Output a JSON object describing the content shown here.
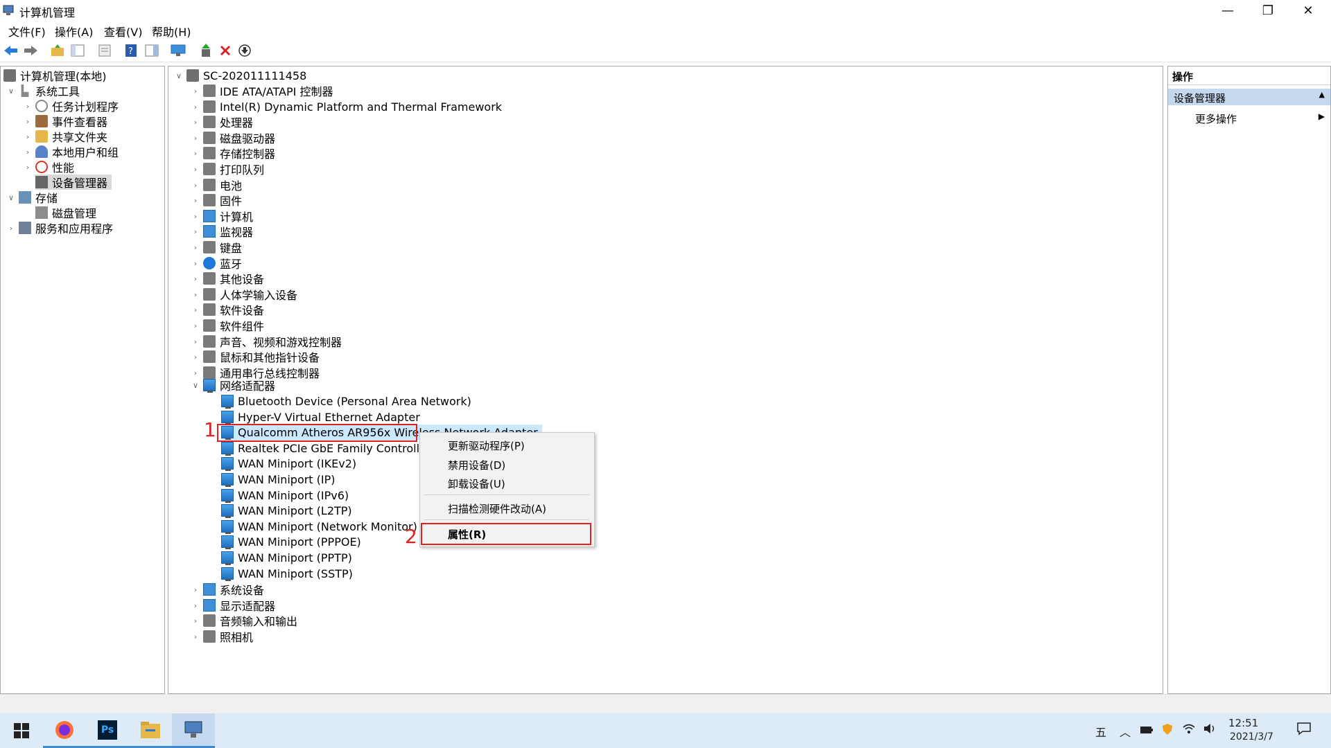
{
  "window": {
    "title": "计算机管理",
    "minimize": "—",
    "restore": "❐",
    "close": "✕"
  },
  "menu": [
    "文件(F)",
    "操作(A)",
    "查看(V)",
    "帮助(H)"
  ],
  "toolbar_icons": [
    "back-arrow-icon",
    "forward-arrow-icon",
    "up-folder-icon",
    "show-hide-tree-icon",
    "export-list-icon",
    "help-icon",
    "details-pane-icon",
    "monitor-icon",
    "update-driver-icon",
    "uninstall-x-icon",
    "download-icon"
  ],
  "left_tree": {
    "root": "计算机管理(本地)",
    "system_tools": "系统工具",
    "task_scheduler": "任务计划程序",
    "event_viewer": "事件查看器",
    "shared_folders": "共享文件夹",
    "local_users": "本地用户和组",
    "performance": "性能",
    "device_manager": "设备管理器",
    "storage": "存储",
    "disk_management": "磁盘管理",
    "services_apps": "服务和应用程序"
  },
  "device_tree": {
    "computer_name": "SC-202011111458",
    "categories_top": [
      "IDE ATA/ATAPI 控制器",
      "Intel(R) Dynamic Platform and Thermal Framework",
      "处理器",
      "磁盘驱动器",
      "存储控制器",
      "打印队列",
      "电池",
      "固件",
      "计算机",
      "监视器",
      "键盘",
      "蓝牙",
      "其他设备",
      "人体学输入设备",
      "软件设备",
      "软件组件",
      "声音、视频和游戏控制器",
      "鼠标和其他指针设备",
      "通用串行总线控制器"
    ],
    "network_adapters": "网络适配器",
    "adapters": [
      "Bluetooth Device (Personal Area Network)",
      "Hyper-V Virtual Ethernet Adapter",
      "Qualcomm Atheros AR956x Wireless Network Adapter",
      "Realtek PCIe GbE Family Controller",
      "WAN Miniport (IKEv2)",
      "WAN Miniport (IP)",
      "WAN Miniport (IPv6)",
      "WAN Miniport (L2TP)",
      "WAN Miniport (Network Monitor)",
      "WAN Miniport (PPPOE)",
      "WAN Miniport (PPTP)",
      "WAN Miniport (SSTP)"
    ],
    "categories_bottom": [
      "系统设备",
      "显示适配器",
      "音频输入和输出",
      "照相机"
    ]
  },
  "context_menu": {
    "update_driver": "更新驱动程序(P)",
    "disable_device": "禁用设备(D)",
    "uninstall_device": "卸载设备(U)",
    "scan_hardware": "扫描检测硬件改动(A)",
    "properties": "属性(R)"
  },
  "annotations": {
    "step1": "1",
    "step2": "2"
  },
  "actions_pane": {
    "header": "操作",
    "section": "设备管理器",
    "more_actions": "更多操作"
  },
  "taskbar": {
    "apps": [
      "windows-start-icon",
      "firefox-icon",
      "photoshop-icon",
      "file-explorer-icon",
      "computer-management-icon"
    ],
    "ps_label": "Ps",
    "ime": "五",
    "time": "12:51",
    "date": "2021/3/7"
  },
  "colors": {
    "annotation_red": "#e02020",
    "selection_blue": "#cce8ff",
    "actions_section": "#c5d9ee"
  }
}
